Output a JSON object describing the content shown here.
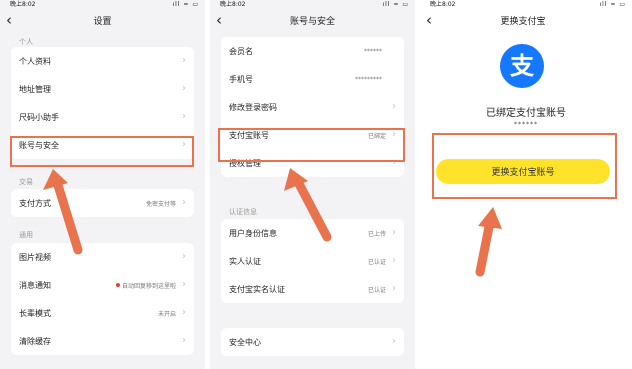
{
  "status": {
    "time": "晚上8:02",
    "icons": "ıll ≈ ▭"
  },
  "screen1": {
    "title": "设置",
    "sections": [
      {
        "header": "个人",
        "items": [
          {
            "label": "个人资料",
            "value": ""
          },
          {
            "label": "地址管理",
            "value": ""
          },
          {
            "label": "尺码小助手",
            "value": ""
          },
          {
            "label": "账号与安全",
            "value": ""
          }
        ]
      },
      {
        "header": "交易",
        "items": [
          {
            "label": "支付方式",
            "value": "免密支付等"
          }
        ]
      },
      {
        "header": "通用",
        "items": [
          {
            "label": "图片视频",
            "value": ""
          },
          {
            "label": "消息通知",
            "value": "自动回复移到这里啦"
          },
          {
            "label": "长辈模式",
            "value": "未开启"
          },
          {
            "label": "清除缓存",
            "value": ""
          }
        ]
      }
    ]
  },
  "screen2": {
    "title": "账号与安全",
    "group1": [
      {
        "label": "会员名",
        "value": "******"
      },
      {
        "label": "手机号",
        "value": "*********"
      },
      {
        "label": "修改登录密码",
        "value": ""
      },
      {
        "label": "支付宝账号",
        "value": "已绑定"
      },
      {
        "label": "授权管理",
        "value": ""
      }
    ],
    "section_header": "认证信息",
    "group2": [
      {
        "label": "用户身份信息",
        "value": "已上传"
      },
      {
        "label": "实人认证",
        "value": "已认证"
      },
      {
        "label": "支付宝实名认证",
        "value": "已认证"
      }
    ],
    "group3": [
      {
        "label": "安全中心",
        "value": ""
      }
    ]
  },
  "screen3": {
    "title": "更换支付宝",
    "logo_glyph": "支",
    "bound_title": "已绑定支付宝账号",
    "masked_account": "******",
    "change_button": "更换支付宝账号"
  },
  "colors": {
    "highlight": "#e8734d",
    "alipay_blue": "#1677ff",
    "button_yellow": "#ffe32b"
  },
  "icons": {
    "back": "‹",
    "chevron": "›"
  }
}
